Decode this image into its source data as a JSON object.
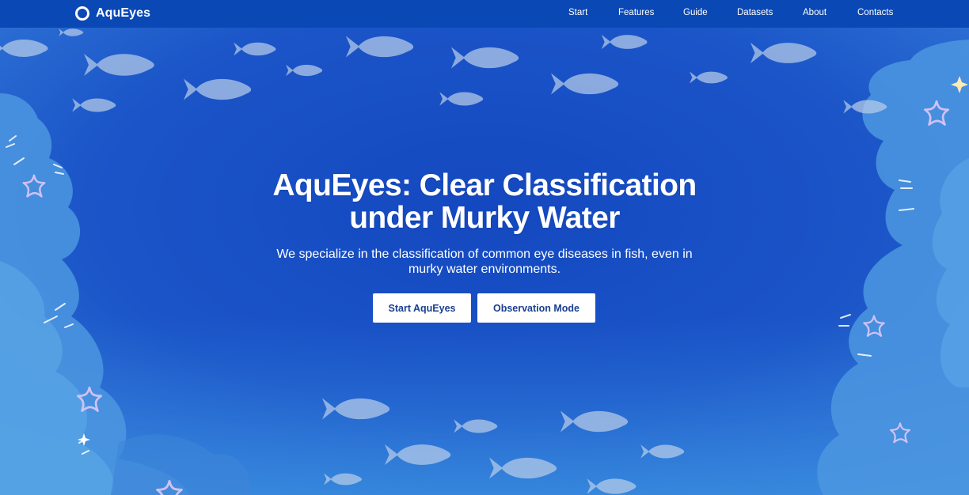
{
  "brand": {
    "name": "AquEyes",
    "logo_icon": "ring-logo-icon"
  },
  "nav": {
    "items": [
      {
        "label": "Start"
      },
      {
        "label": "Features"
      },
      {
        "label": "Guide"
      },
      {
        "label": "Datasets"
      },
      {
        "label": "About"
      },
      {
        "label": "Contacts"
      }
    ]
  },
  "hero": {
    "title_line1": "AquEyes: Clear Classification",
    "title_line2": "under Murky Water",
    "subtitle_line1": "We specialize in the classification of common eye diseases in fish, even in",
    "subtitle_line2": "murky water environments.",
    "primary_button": "Start AquEyes",
    "secondary_button": "Observation Mode"
  },
  "colors": {
    "navbar": "#0a48b5",
    "ocean_deep": "#1546b8",
    "ocean_light": "#4f9fe0",
    "reef": "#5aa6e6",
    "fish": "#b9cde9",
    "starfish": "#c9bff2",
    "button_bg": "#ffffff",
    "button_text": "#1a3f8f"
  }
}
